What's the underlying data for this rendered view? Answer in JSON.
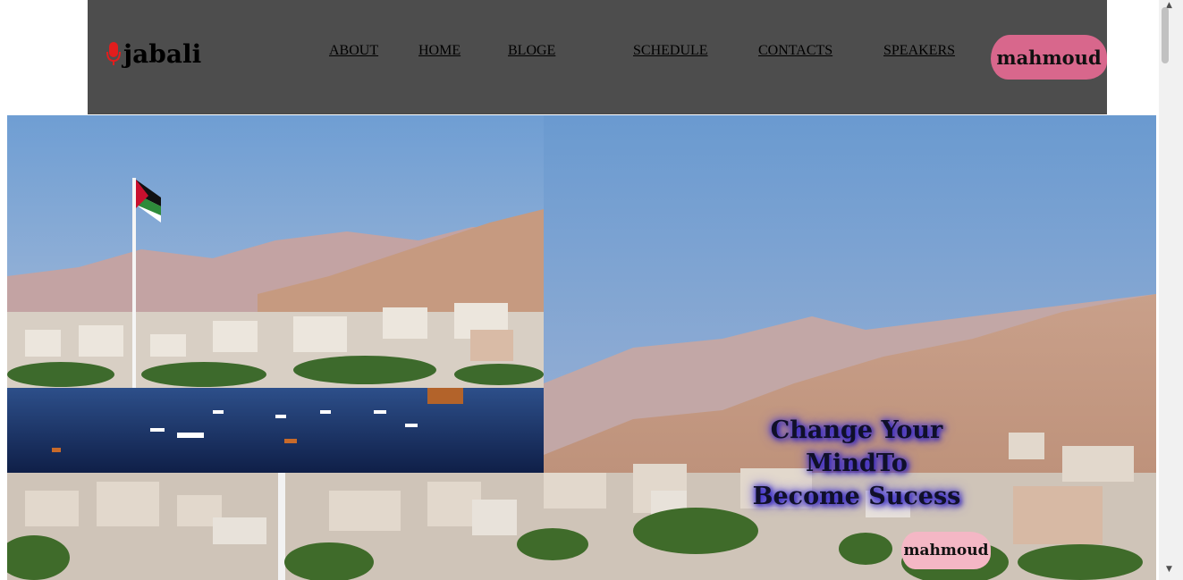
{
  "nav": {
    "brand": "jabali",
    "links": [
      {
        "label": "ABOUT"
      },
      {
        "label": "HOME"
      },
      {
        "label": "BLOGE"
      },
      {
        "label": "SCHEDULE"
      },
      {
        "label": "CONTACTS"
      },
      {
        "label": "SPEAKERS"
      }
    ],
    "user_button": "mahmoud",
    "brand_icon": "microphone-icon"
  },
  "hero": {
    "tagline": "Change Your MindTo Become Sucess",
    "cta_button": "mahmoud"
  },
  "colors": {
    "navbar": "#4d4d4d",
    "nav_button": "#d8678c",
    "cta_button": "#f4b7c5",
    "mic_icon": "#e11d1d",
    "tagline_glow": "#3a2fd0"
  }
}
